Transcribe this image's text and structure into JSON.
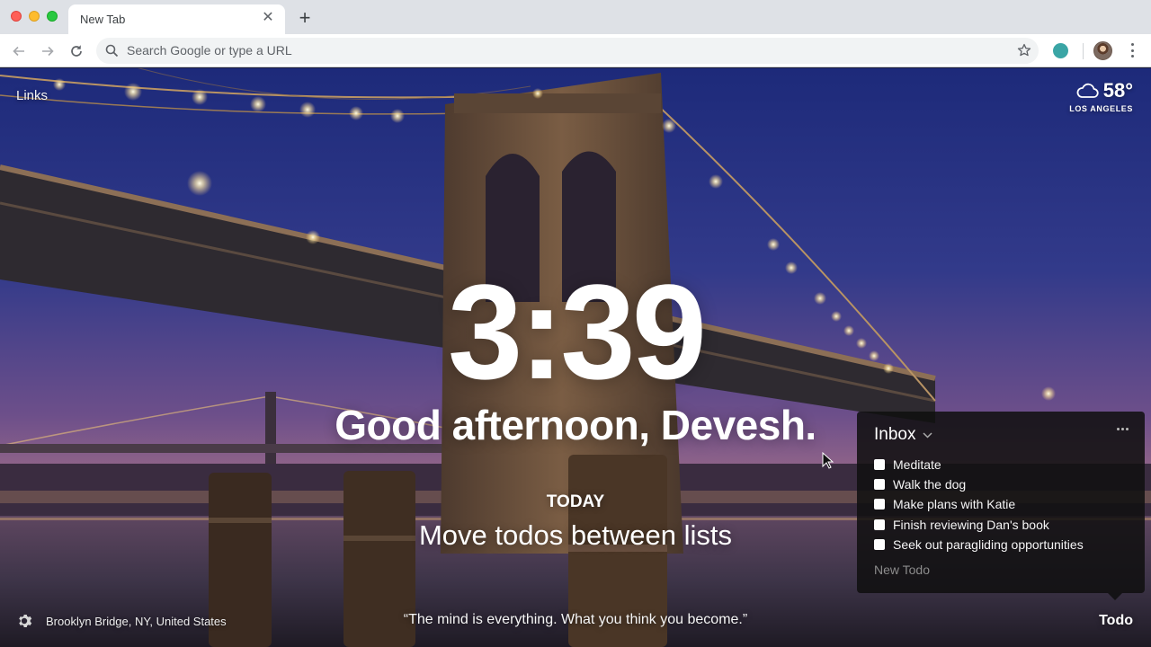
{
  "browser": {
    "tab_title": "New Tab",
    "tab_close_glyph": "✕",
    "new_tab_glyph": "+",
    "omnibox_placeholder": "Search Google or type a URL",
    "icons": [
      "back-icon",
      "forward-icon",
      "reload-icon",
      "search-icon",
      "star-icon",
      "extension-icon",
      "profile-avatar",
      "menu-icon"
    ]
  },
  "page": {
    "links_label": "Links",
    "weather": {
      "temperature": "58°",
      "location": "LOS ANGELES",
      "icon": "cloud-icon"
    },
    "clock": "3:39",
    "greeting": "Good afternoon, Devesh.",
    "focus": {
      "label": "TODAY",
      "text": "Move todos between lists"
    },
    "todo_panel": {
      "list_name": "Inbox",
      "items": [
        {
          "text": "Meditate",
          "done": false
        },
        {
          "text": "Walk the dog",
          "done": false
        },
        {
          "text": "Make plans with Katie",
          "done": false
        },
        {
          "text": "Finish reviewing Dan's book",
          "done": false
        },
        {
          "text": "Seek out paragliding opportunities",
          "done": false
        }
      ],
      "new_todo_placeholder": "New Todo"
    },
    "footer": {
      "photo_location": "Brooklyn Bridge, NY, United States",
      "quote": "“The mind is everything. What you think you become.”",
      "todo_label": "Todo"
    }
  }
}
